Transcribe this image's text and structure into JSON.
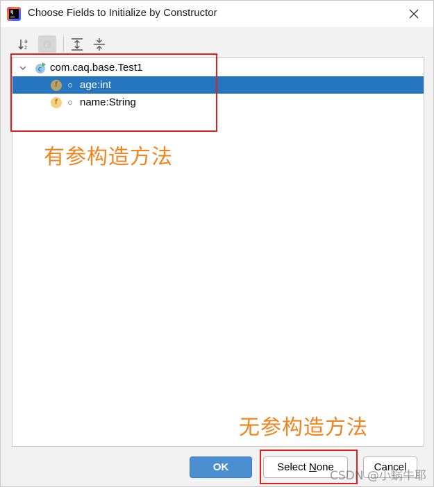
{
  "window": {
    "title": "Choose Fields to Initialize by Constructor"
  },
  "tree": {
    "root_label": "com.caq.base.Test1",
    "root_icon_letter": "c",
    "items": [
      {
        "label": "age:int",
        "icon_letter": "f",
        "selected": true
      },
      {
        "label": "name:String",
        "icon_letter": "f",
        "selected": false
      }
    ]
  },
  "annotations": {
    "with_params": "有参构造方法",
    "without_params": "无参构造方法"
  },
  "buttons": {
    "ok": "OK",
    "select_none_prefix": "Select ",
    "select_none_mnemonic": "N",
    "select_none_suffix": "one",
    "cancel": "Cancel"
  },
  "watermark": "CSDN @小蜗牛耶",
  "colors": {
    "selection": "#2675bf",
    "ok_button": "#4b8fd1",
    "annotation_box": "#e02020",
    "annotation_text": "#f0841e"
  }
}
